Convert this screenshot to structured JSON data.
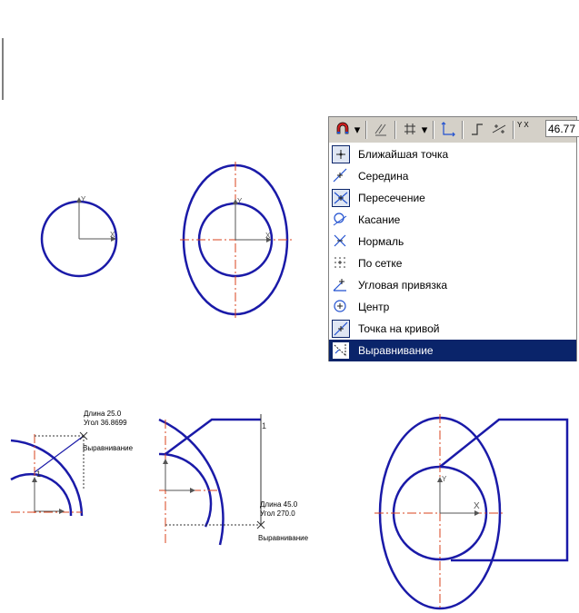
{
  "colors": {
    "contour": "#1a1aa8",
    "axis": "#d9431c",
    "menu_selected": "#0a246a",
    "menu_bg": "#d4d0c8"
  },
  "toolbar": {
    "coord_prefix": "Y X",
    "coord_value": "46.77"
  },
  "snap_menu": {
    "items": [
      {
        "label": "Ближайшая точка",
        "icon": "nearest-point-icon"
      },
      {
        "label": "Середина",
        "icon": "midpoint-icon"
      },
      {
        "label": "Пересечение",
        "icon": "intersection-icon"
      },
      {
        "label": "Касание",
        "icon": "tangent-icon"
      },
      {
        "label": "Нормаль",
        "icon": "normal-icon"
      },
      {
        "label": "По сетке",
        "icon": "grid-icon"
      },
      {
        "label": "Угловая привязка",
        "icon": "angle-snap-icon"
      },
      {
        "label": "Центр",
        "icon": "center-icon"
      },
      {
        "label": "Точка на кривой",
        "icon": "point-on-curve-icon"
      },
      {
        "label": "Выравнивание",
        "icon": "alignment-icon"
      }
    ],
    "selected_index": 9
  },
  "annotations": {
    "axis_x": "X",
    "axis_y": "Y",
    "point_1": "1",
    "tooltip1": {
      "length": "Длина 25.0",
      "angle": "Угол 36.8699",
      "mode": "Выравнивание"
    },
    "tooltip2": {
      "length": "Длина 45.0",
      "angle": "Угол 270.0",
      "mode": "Выравнивание"
    }
  }
}
